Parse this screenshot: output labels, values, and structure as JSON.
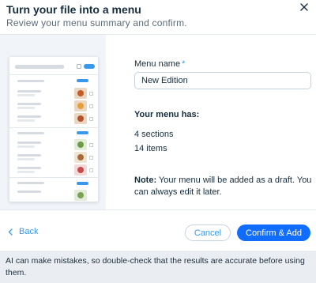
{
  "dialog": {
    "title": "Turn your file into a menu",
    "subtitle": "Review your menu summary and confirm.",
    "close_icon": "close-icon"
  },
  "form": {
    "menu_name_label": "Menu name",
    "required_mark": "*",
    "menu_name_value": "New Edition"
  },
  "summary": {
    "heading": "Your menu has:",
    "sections": "4 sections",
    "items": "14 items"
  },
  "note": {
    "prefix": "Note:",
    "text": " Your menu will be added as a draft. You can always edit it later."
  },
  "actions": {
    "back_label": "Back",
    "cancel_label": "Cancel",
    "confirm_label": "Confirm & Add"
  },
  "footer": {
    "disclaimer": "AI can make mistakes, so double-check that the results are accurate before using them."
  },
  "colors": {
    "accent": "#116dff",
    "link": "#3899ec",
    "preview_bg": "#f1f4f8",
    "footer_bg": "#eaeef2"
  }
}
